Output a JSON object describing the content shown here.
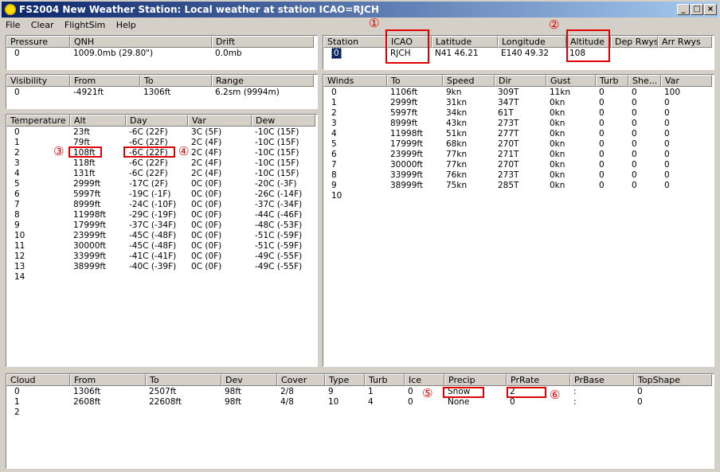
{
  "window": {
    "title": "FS2004 New Weather Station: Local weather at station  ICAO=RJCH"
  },
  "menu": [
    "File",
    "Clear",
    "FlightSim",
    "Help"
  ],
  "pressure": {
    "headers": [
      "Pressure",
      "QNH",
      "Drift"
    ],
    "rows": [
      [
        "0",
        "1009.0mb (29.80\")",
        "0.0mb"
      ]
    ]
  },
  "station": {
    "headers": [
      "Station",
      "ICAO",
      "Latitude",
      "Longitude",
      "Altitude",
      "Dep Rwys",
      "Arr Rwys"
    ],
    "rows": [
      [
        "0",
        "RJCH",
        "N41 46.21",
        "E140 49.32",
        "108",
        "",
        ""
      ]
    ]
  },
  "visibility": {
    "headers": [
      "Visibility",
      "From",
      "To",
      "Range"
    ],
    "rows": [
      [
        "0",
        "-4921ft",
        "1306ft",
        "6.2sm (9994m)"
      ]
    ]
  },
  "winds": {
    "headers": [
      "Winds",
      "To",
      "Speed",
      "Dir",
      "Gust",
      "Turb",
      "She...",
      "Var"
    ],
    "rows": [
      [
        "0",
        "1106ft",
        "9kn",
        "309T",
        "11kn",
        "0",
        "0",
        "100"
      ],
      [
        "1",
        "2999ft",
        "31kn",
        "347T",
        "0kn",
        "0",
        "0",
        "0"
      ],
      [
        "2",
        "5997ft",
        "34kn",
        "61T",
        "0kn",
        "0",
        "0",
        "0"
      ],
      [
        "3",
        "8999ft",
        "43kn",
        "273T",
        "0kn",
        "0",
        "0",
        "0"
      ],
      [
        "4",
        "11998ft",
        "51kn",
        "277T",
        "0kn",
        "0",
        "0",
        "0"
      ],
      [
        "5",
        "17999ft",
        "68kn",
        "270T",
        "0kn",
        "0",
        "0",
        "0"
      ],
      [
        "6",
        "23999ft",
        "77kn",
        "271T",
        "0kn",
        "0",
        "0",
        "0"
      ],
      [
        "7",
        "30000ft",
        "77kn",
        "270T",
        "0kn",
        "0",
        "0",
        "0"
      ],
      [
        "8",
        "33999ft",
        "76kn",
        "273T",
        "0kn",
        "0",
        "0",
        "0"
      ],
      [
        "9",
        "38999ft",
        "75kn",
        "285T",
        "0kn",
        "0",
        "0",
        "0"
      ],
      [
        "10",
        "",
        "",
        "",
        "",
        "",
        "",
        ""
      ]
    ]
  },
  "temperature": {
    "headers": [
      "Temperature",
      "Alt",
      "Day",
      "Var",
      "Dew"
    ],
    "rows": [
      [
        "0",
        "23ft",
        "-6C (22F)",
        "3C (5F)",
        "-10C (15F)"
      ],
      [
        "1",
        "79ft",
        "-6C (22F)",
        "2C (4F)",
        "-10C (15F)"
      ],
      [
        "2",
        "108ft",
        "-6C (22F)",
        "2C (4F)",
        "-10C (15F)"
      ],
      [
        "3",
        "118ft",
        "-6C (22F)",
        "2C (4F)",
        "-10C (15F)"
      ],
      [
        "4",
        "131ft",
        "-6C (22F)",
        "2C (4F)",
        "-10C (15F)"
      ],
      [
        "5",
        "2999ft",
        "-17C (2F)",
        "0C (0F)",
        "-20C (-3F)"
      ],
      [
        "6",
        "5997ft",
        "-19C (-1F)",
        "0C (0F)",
        "-26C (-14F)"
      ],
      [
        "7",
        "8999ft",
        "-24C (-10F)",
        "0C (0F)",
        "-37C (-34F)"
      ],
      [
        "8",
        "11998ft",
        "-29C (-19F)",
        "0C (0F)",
        "-44C (-46F)"
      ],
      [
        "9",
        "17999ft",
        "-37C (-34F)",
        "0C (0F)",
        "-48C (-53F)"
      ],
      [
        "10",
        "23999ft",
        "-45C (-48F)",
        "0C (0F)",
        "-51C (-59F)"
      ],
      [
        "11",
        "30000ft",
        "-45C (-48F)",
        "0C (0F)",
        "-51C (-59F)"
      ],
      [
        "12",
        "33999ft",
        "-41C (-41F)",
        "0C (0F)",
        "-49C (-55F)"
      ],
      [
        "13",
        "38999ft",
        "-40C (-39F)",
        "0C (0F)",
        "-49C (-55F)"
      ],
      [
        "14",
        "",
        "",
        "",
        ""
      ]
    ]
  },
  "cloud": {
    "headers": [
      "Cloud",
      "From",
      "To",
      "Dev",
      "Cover",
      "Type",
      "Turb",
      "Ice",
      "Precip",
      "PrRate",
      "PrBase",
      "TopShape"
    ],
    "rows": [
      [
        "0",
        "1306ft",
        "2507ft",
        "98ft",
        "2/8",
        "9",
        "1",
        "0",
        "Snow",
        "2",
        ":",
        "0"
      ],
      [
        "1",
        "2608ft",
        "22608ft",
        "98ft",
        "4/8",
        "10",
        "4",
        "0",
        "None",
        "0",
        ":",
        "0"
      ],
      [
        "2",
        "",
        "",
        "",
        "",
        "",
        "",
        "",
        "",
        "",
        "",
        ""
      ]
    ]
  },
  "annotations": {
    "markers": [
      "①",
      "②",
      "③",
      "④",
      "⑤",
      "⑥"
    ],
    "color": "#e00000"
  }
}
